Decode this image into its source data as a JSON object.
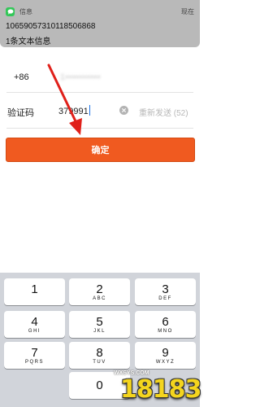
{
  "notification": {
    "app_name": "信息",
    "time": "现在",
    "sender": "10659057310118506868",
    "body": "1条文本信息"
  },
  "phone_row": {
    "country_code": "+86",
    "phone_value": "1••••••••••"
  },
  "code_row": {
    "label": "验证码",
    "value": "379991",
    "resend": "重新发送 (52)"
  },
  "confirm_button": "确定",
  "keypad": {
    "keys": [
      {
        "num": "1",
        "letters": ""
      },
      {
        "num": "2",
        "letters": "ABC"
      },
      {
        "num": "3",
        "letters": "DEF"
      },
      {
        "num": "4",
        "letters": "GHI"
      },
      {
        "num": "5",
        "letters": "JKL"
      },
      {
        "num": "6",
        "letters": "MNO"
      },
      {
        "num": "7",
        "letters": "PQRS"
      },
      {
        "num": "8",
        "letters": "TUV"
      },
      {
        "num": "9",
        "letters": "WXYZ"
      },
      {
        "num": "0",
        "letters": ""
      }
    ]
  },
  "watermark": {
    "site": "WXSYS.COM",
    "text": "18183"
  },
  "colors": {
    "accent": "#f05a20",
    "annotation_arrow": "#e0201a",
    "notification_bg": "#b9b9b9",
    "keypad_bg": "#d1d4da"
  },
  "icons": {
    "app": "message-bubble-icon",
    "clear": "clear-x-icon",
    "annotation": "red-arrow-icon"
  }
}
